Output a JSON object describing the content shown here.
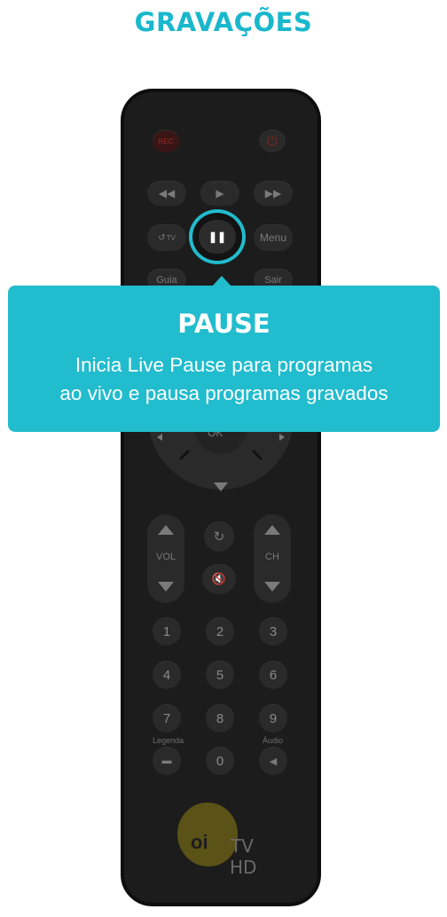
{
  "page": {
    "title": "GRAVAÇÕES"
  },
  "remote": {
    "rec": "REC",
    "power_icon": "power-icon",
    "rewind_icon": "rewind-icon",
    "play_icon": "play-icon",
    "ffwd_icon": "fast-forward-icon",
    "tv_label": "TV",
    "pause_icon": "pause-icon",
    "menu": "Menu",
    "guia": "Guia",
    "sair": "Sair",
    "ok": "OK",
    "vol": "VOL",
    "ch": "CH",
    "legenda": "Legenda",
    "audio": "Áudio",
    "digits": [
      "1",
      "2",
      "3",
      "4",
      "5",
      "6",
      "7",
      "8",
      "9",
      "0"
    ],
    "logo_brand": "oi",
    "logo_tv": "TV",
    "logo_hd": "HD"
  },
  "tooltip": {
    "title": "PAUSE",
    "line1": "Inicia Live Pause para programas",
    "line2": "ao vivo e pausa programas gravados"
  },
  "colors": {
    "accent": "#21bccd",
    "remote": "#1c1c1c"
  }
}
